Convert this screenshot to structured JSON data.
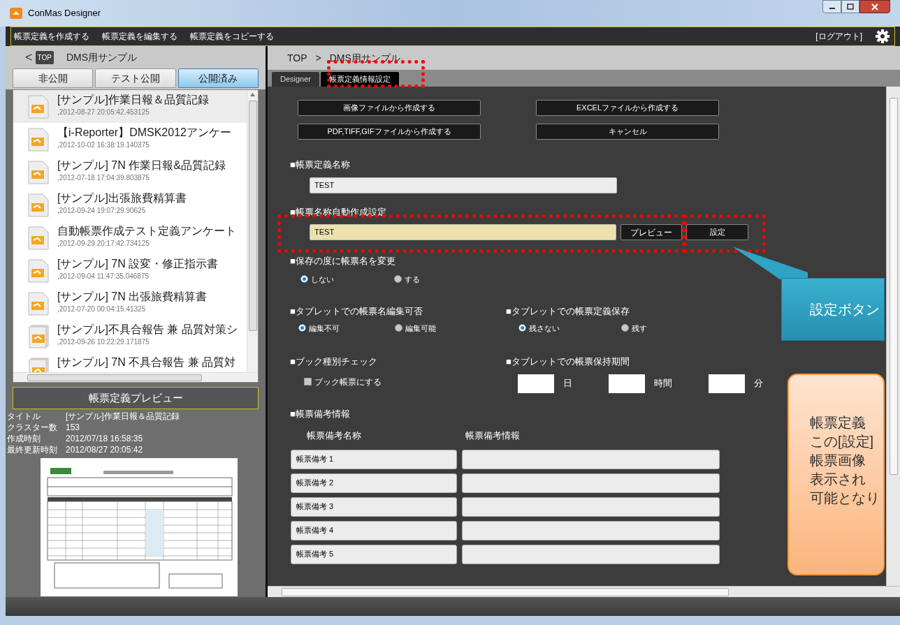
{
  "window": {
    "title": "ConMas Designer"
  },
  "menu": {
    "items": [
      "帳票定義を作成する",
      "帳票定義を編集する",
      "帳票定義をコピーする"
    ],
    "logout": "[ログアウト]"
  },
  "left": {
    "breadcrumb": {
      "back": "<",
      "top": "TOP",
      "title": "DMS用サンプル"
    },
    "tabs": [
      {
        "label": "非公開",
        "selected": false
      },
      {
        "label": "テスト公開",
        "selected": false
      },
      {
        "label": "公開済み",
        "selected": true
      }
    ],
    "items": [
      {
        "title": "[サンプル]作業日報＆品質記録",
        "date": ",2012-08-27 20:05:42.453125",
        "kind": "single",
        "selected": true
      },
      {
        "title": "【i-Reporter】DMSK2012アンケー",
        "date": ",2012-10-02 16:38:19.140375",
        "kind": "single",
        "selected": false
      },
      {
        "title": "[サンプル] 7N 作業日報&品質記録",
        "date": ",2012-07-18 17:04:39.803875",
        "kind": "single",
        "selected": false
      },
      {
        "title": "[サンプル]出張旅費精算書",
        "date": ",2012-09-24 19:07:29.90625",
        "kind": "single",
        "selected": false
      },
      {
        "title": "自動帳票作成テスト定義アンケート",
        "date": ",2012-09-29 20:17:42.734125",
        "kind": "single",
        "selected": false
      },
      {
        "title": "[サンプル] 7N 設変・修正指示書",
        "date": ",2012-09-04 11:47:35.046875",
        "kind": "single",
        "selected": false
      },
      {
        "title": "[サンプル] 7N 出張旅費精算書",
        "date": ",2012-07-20 00:04:15.41325",
        "kind": "single",
        "selected": false
      },
      {
        "title": "[サンプル]不具合報告 兼 品質対策シ",
        "date": ",2012-09-26 10:22:29.171875",
        "kind": "book",
        "selected": false
      },
      {
        "title": "[サンプル] 7N 不具合報告 兼 品質対",
        "kind": "book",
        "selected": false
      }
    ],
    "preview": {
      "header": "帳票定義プレビュー",
      "fields": [
        {
          "label": "タイトル",
          "value": "[サンプル]作業日報＆品質記録"
        },
        {
          "label": "クラスター数",
          "value": "153"
        },
        {
          "label": "作成時刻",
          "value": "2012/07/18 16:58:35"
        },
        {
          "label": "最終更新時刻",
          "value": "2012/08/27 20:05:42"
        }
      ]
    }
  },
  "right": {
    "breadcrumb": {
      "top": "TOP",
      "sep": ">",
      "title": "DMS用サンプル"
    },
    "tabs": [
      {
        "label": "Designer",
        "selected": false
      },
      {
        "label": "帳票定義情報設定",
        "selected": true
      }
    ],
    "buttons": [
      "画像ファイルから作成する",
      "EXCELファイルから作成する",
      "PDF,TIFF,GIFファイルから作成する",
      "キャンセル"
    ],
    "name": {
      "label": "■帳票定義名称",
      "value": "TEST"
    },
    "auto_name": {
      "label": "■帳票名称自動作成設定",
      "value": "TEST",
      "preview_button": "プレビュー",
      "settings_button": "設定"
    },
    "rename_on_save": {
      "label": "■保存の度に帳票名を変更",
      "options": [
        {
          "label": "しない",
          "selected": true
        },
        {
          "label": "する",
          "selected": false
        }
      ]
    },
    "tablet_edit": {
      "label": "■タブレットでの帳票名編集可否",
      "options": [
        {
          "label": "編集不可",
          "selected": true
        },
        {
          "label": "編集可能",
          "selected": false
        }
      ]
    },
    "tablet_save": {
      "label": "■タブレットでの帳票定義保存",
      "options": [
        {
          "label": "残さない",
          "selected": true
        },
        {
          "label": "残す",
          "selected": false
        }
      ]
    },
    "book_check": {
      "label": "■ブック種別チェック",
      "checkbox": "ブック帳票にする",
      "checked": false
    },
    "retention": {
      "label": "■タブレットでの帳票保持期間",
      "units": [
        "日",
        "時間",
        "分"
      ]
    },
    "notes": {
      "label": "■帳票備考情報",
      "headers": [
        "帳票備考名称",
        "帳票備考情報"
      ],
      "rows": [
        "帳票備考 1",
        "帳票備考 2",
        "帳票備考 3",
        "帳票備考 4",
        "帳票備考 5"
      ]
    }
  },
  "callouts": [
    {
      "kind": "teal",
      "lines": [
        "設定ボタン"
      ]
    },
    {
      "kind": "orange",
      "lines": [
        "帳票定義",
        "この[設定]",
        "帳票画像",
        "表示され",
        "可能となり"
      ]
    }
  ]
}
